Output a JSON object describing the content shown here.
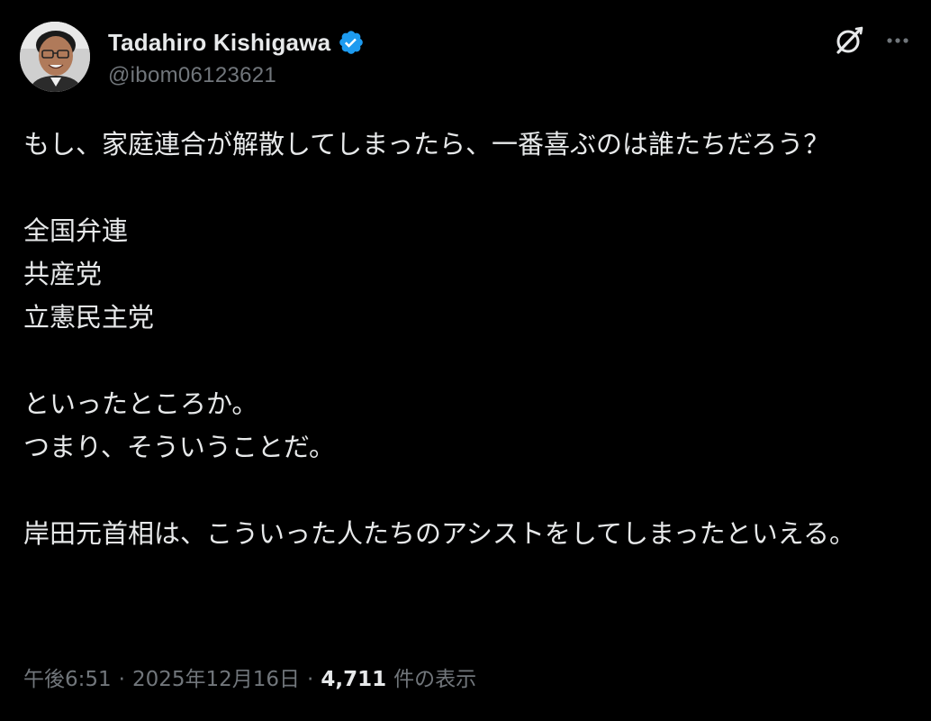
{
  "author": {
    "display_name": "Tadahiro Kishigawa",
    "handle": "@ibom06123621",
    "verified": true,
    "verified_color": "#1d9bf0"
  },
  "icons": {
    "grok": "grok-icon",
    "more": "more-options-icon",
    "verified": "verified-badge-icon"
  },
  "tweet": {
    "paragraphs": [
      [
        "もし、家庭連合が解散してしまったら、一番喜ぶのは誰たちだろう？"
      ],
      [
        "全国弁連",
        "共産党",
        "立憲民主党"
      ],
      [
        "といったところか。",
        "つまり、そういうことだ。"
      ],
      [
        "岸田元首相は、こういった人たちのアシストをしてしまったといえる。"
      ]
    ]
  },
  "meta": {
    "time": "午後6:51",
    "date": "2025年12月16日",
    "separator": "·",
    "views_count": "4,711",
    "views_label": "件の表示"
  },
  "colors": {
    "background": "#000000",
    "text_primary": "#e7e9ea",
    "text_secondary": "#71767b"
  }
}
